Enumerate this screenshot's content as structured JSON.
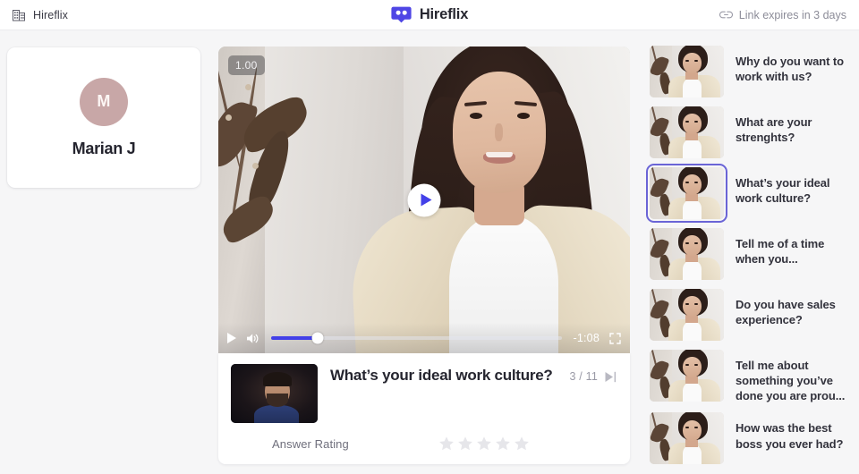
{
  "topbar": {
    "company_label": "Hireflix",
    "company_icon": "building-icon",
    "brand_label": "Hireflix",
    "brand_icon": "hireflix-logo-icon",
    "link_icon": "link-icon",
    "expiry_label": "Link expires in 3 days"
  },
  "candidate": {
    "initial": "M",
    "name": "Marian J",
    "avatar_color": "#c8a7a7"
  },
  "player": {
    "speed_badge": "1.00",
    "play_icon": "play-icon",
    "volume_icon": "volume-icon",
    "fullscreen_icon": "fullscreen-icon",
    "time_remaining": "-1:08",
    "progress_percent": 16,
    "accent_color": "#4340e8"
  },
  "answer": {
    "question": "What’s your ideal work culture?",
    "counter": "3 / 11",
    "skip_icon": "skip-next-icon",
    "rating_label": "Answer Rating",
    "stars_total": 5,
    "stars_filled": 0,
    "star_color": "#e6e6ea",
    "interviewer_thumb": "interviewer-thumbnail"
  },
  "questions": {
    "selected_index": 2,
    "selected_border_color": "#6a64d6",
    "items": [
      {
        "label": "Why do you want to work with us?"
      },
      {
        "label": "What are your strenghts?"
      },
      {
        "label": "What’s your ideal work culture?"
      },
      {
        "label": "Tell me of a time when you..."
      },
      {
        "label": "Do you have sales experience?"
      },
      {
        "label": "Tell me about something you’ve done you are prou..."
      },
      {
        "label": "How was the best boss you ever had?"
      }
    ]
  }
}
